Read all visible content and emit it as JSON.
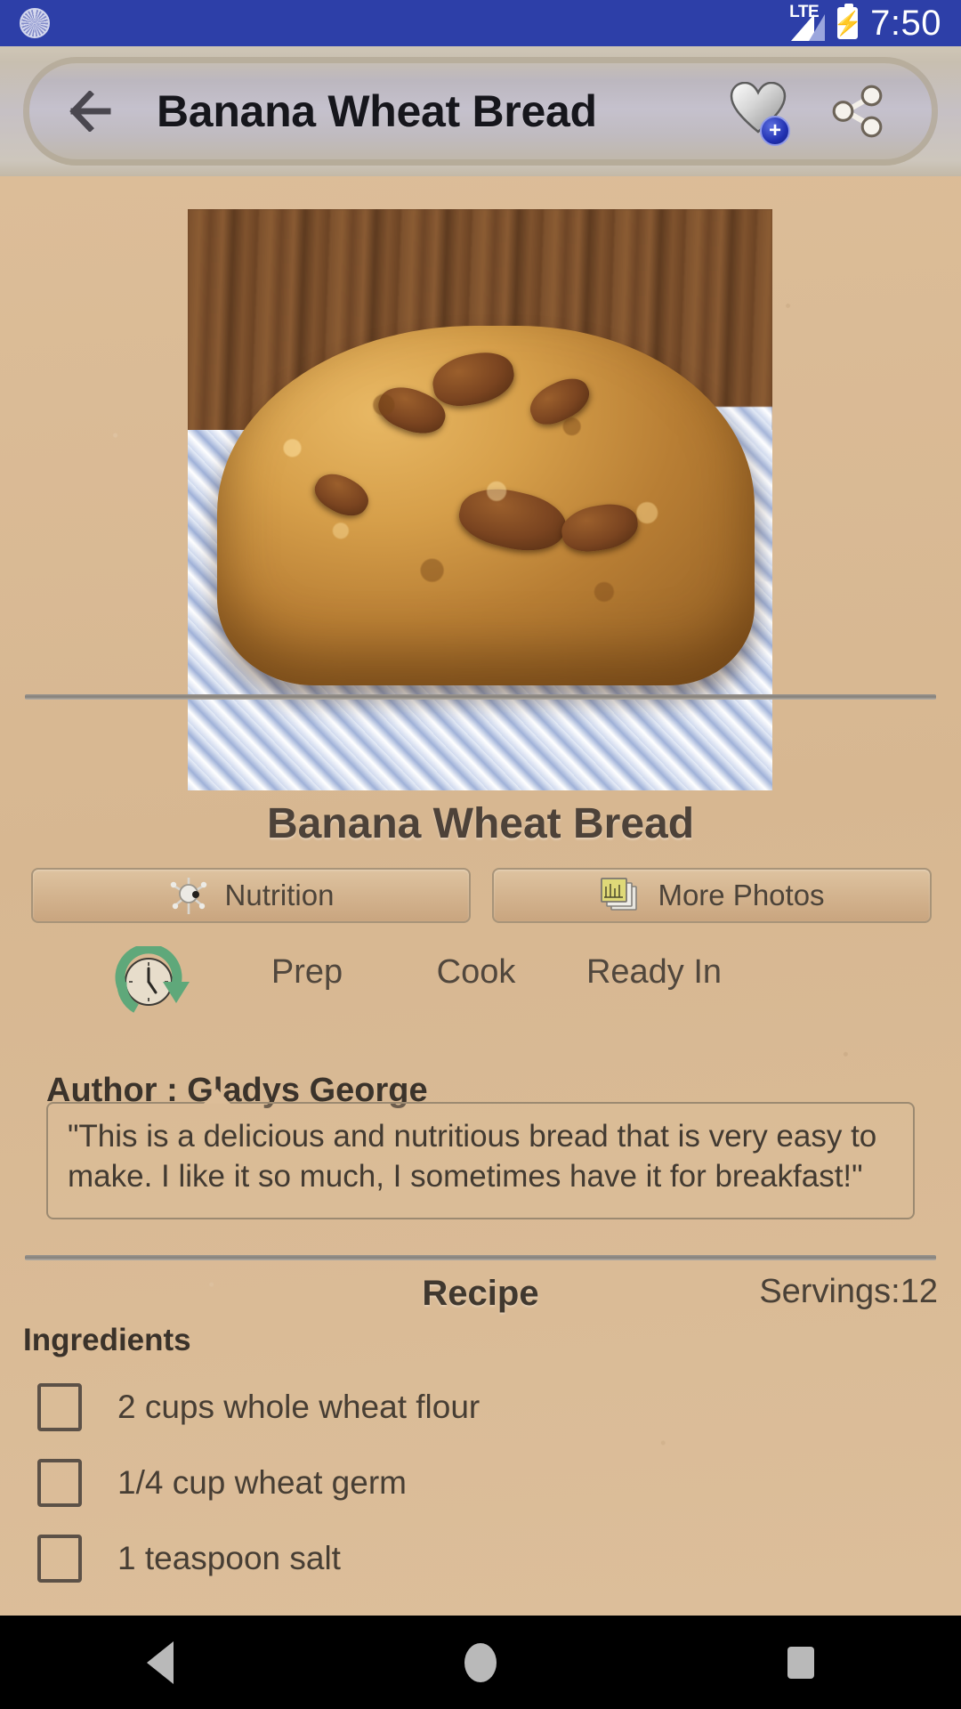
{
  "status_bar": {
    "left_icon": "sunburst-icon",
    "network_label": "LTE",
    "signal_icon": "signal-bars-icon",
    "battery_icon": "battery-charging-icon",
    "time": "7:50",
    "background_color": "#2d3fa8"
  },
  "app_bar": {
    "back_icon": "back-arrow-icon",
    "title": "Banana Wheat Bread",
    "favorite_icon": "heart-add-icon",
    "favorite_badge": "+",
    "share_icon": "share-icon",
    "background_color": "#c6c0c4"
  },
  "recipe": {
    "photo_alt": "banana-wheat-bread-loaf-photo",
    "caption": "Banana Wheat Bread",
    "author_label": "Author : Gladys George",
    "description": "\"This is a delicious and nutritious bread that is very easy to make.  I like  it so much, I sometimes have it for breakfast!\"",
    "section_title": "Recipe",
    "servings": "Servings:12",
    "ingredients_header": "Ingredients"
  },
  "buttons": {
    "nutrition": {
      "label": "Nutrition",
      "icon": "nutrition-icon"
    },
    "more_photos": {
      "label": "More Photos",
      "icon": "photo-stack-icon"
    }
  },
  "times": {
    "clock_icon": "clock-refresh-icon",
    "prep": {
      "label": "Prep",
      "value": ""
    },
    "cook": {
      "label": "Cook",
      "value": ""
    },
    "ready_in": {
      "label": "Ready In",
      "value": ""
    }
  },
  "ingredients": [
    {
      "text": "2 cups whole wheat flour",
      "checked": false
    },
    {
      "text": "1/4 cup wheat germ",
      "checked": false
    },
    {
      "text": "1 teaspoon salt",
      "checked": false
    }
  ],
  "nav_bar": {
    "back": "nav-back-icon",
    "home": "nav-home-icon",
    "recent": "nav-recent-icon"
  },
  "colors": {
    "status_blue": "#2d3fa8",
    "paper_tan": "#d9ba95",
    "text_dark": "#423a31",
    "divider": "#85817b"
  }
}
